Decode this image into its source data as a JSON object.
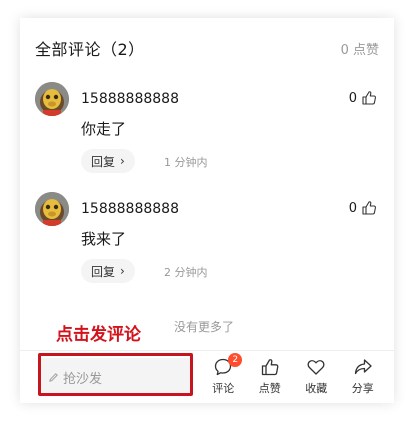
{
  "header": {
    "title": "全部评论（2）",
    "likes": "0 点赞"
  },
  "comments": [
    {
      "username": "15888888888",
      "content": "你走了",
      "likes": "0",
      "reply_label": "回复",
      "time": "1 分钟内"
    },
    {
      "username": "15888888888",
      "content": "我来了",
      "likes": "0",
      "reply_label": "回复",
      "time": "2 分钟内"
    }
  ],
  "no_more": "没有更多了",
  "annotation": "点击发评论",
  "bottom_bar": {
    "input_placeholder": "抢沙发",
    "actions": [
      {
        "label": "评论",
        "icon": "comment-icon",
        "badge": "2"
      },
      {
        "label": "点赞",
        "icon": "thumbs-up-icon"
      },
      {
        "label": "收藏",
        "icon": "heart-icon"
      },
      {
        "label": "分享",
        "icon": "share-icon"
      }
    ]
  },
  "colors": {
    "annotation_red": "#c8141f",
    "badge": "#ff4d2e",
    "muted": "#999999"
  }
}
